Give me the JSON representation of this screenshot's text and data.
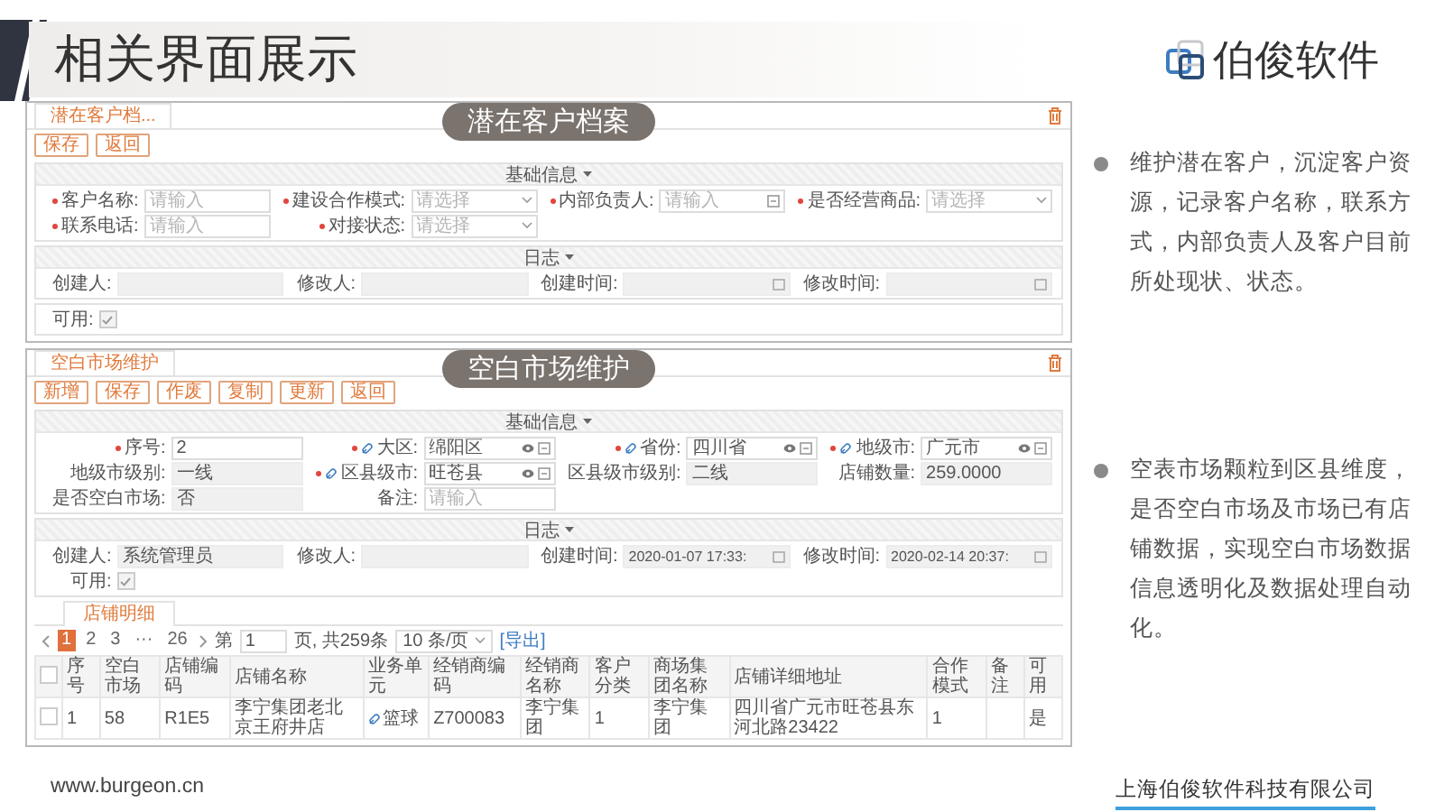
{
  "slide": {
    "title": "相关界面展示",
    "logo": "伯俊软件",
    "website": "www.burgeon.cn",
    "company": "上海伯俊软件科技有限公司"
  },
  "panels": [
    {
      "tab": "潜在客户档...",
      "overlay_title": "潜在客户档案",
      "buttons": [
        "保存",
        "返回"
      ],
      "sections": [
        {
          "title": "基础信息",
          "fields": [
            {
              "kind": "text",
              "label": "客户名称:",
              "required": true,
              "placeholder": "请输入"
            },
            {
              "kind": "select",
              "label": "建设合作模式:",
              "required": true,
              "placeholder": "请选择"
            },
            {
              "kind": "lookup",
              "label": "内部负责人:",
              "required": true,
              "placeholder": "请输入"
            },
            {
              "kind": "select",
              "label": "是否经营商品:",
              "required": true,
              "placeholder": "请选择"
            },
            {
              "kind": "text",
              "label": "联系电话:",
              "required": true,
              "placeholder": "请输入"
            },
            {
              "kind": "select",
              "label": "对接状态:",
              "required": true,
              "placeholder": "请选择"
            }
          ]
        },
        {
          "title": "日志",
          "fields": [
            {
              "kind": "text",
              "label": "创建人:",
              "disabled": true
            },
            {
              "kind": "text",
              "label": "修改人:",
              "disabled": true
            },
            {
              "kind": "date",
              "label": "创建时间:",
              "disabled": true
            },
            {
              "kind": "date",
              "label": "修改时间:",
              "disabled": true
            }
          ]
        },
        {
          "fields": [
            {
              "kind": "checkbox",
              "label": "可用:",
              "checked": true
            }
          ]
        }
      ]
    },
    {
      "tab": "空白市场维护",
      "overlay_title": "空白市场维护",
      "buttons": [
        "新增",
        "保存",
        "作废",
        "复制",
        "更新",
        "返回"
      ],
      "sections": [
        {
          "title": "基础信息",
          "fields": [
            {
              "kind": "text",
              "label": "序号:",
              "required": true,
              "value": "2"
            },
            {
              "kind": "lookup",
              "label": "大区:",
              "required": true,
              "link": true,
              "eye": true,
              "value": "绵阳区"
            },
            {
              "kind": "lookup",
              "label": "省份:",
              "required": true,
              "link": true,
              "eye": true,
              "value": "四川省"
            },
            {
              "kind": "lookup",
              "label": "地级市:",
              "required": true,
              "link": true,
              "eye": true,
              "value": "广元市"
            },
            {
              "kind": "text",
              "label": "地级市级别:",
              "disabled": true,
              "value": "一线"
            },
            {
              "kind": "lookup",
              "label": "区县级市:",
              "required": true,
              "link": true,
              "eye": true,
              "value": "旺苍县"
            },
            {
              "kind": "text",
              "label": "区县级市级别:",
              "disabled": true,
              "value": "二线"
            },
            {
              "kind": "text",
              "label": "店铺数量:",
              "disabled": true,
              "value": "259.0000"
            },
            {
              "kind": "text",
              "label": "是否空白市场:",
              "disabled": true,
              "value": "否"
            },
            {
              "kind": "text",
              "label": "备注:",
              "placeholder": "请输入"
            }
          ]
        },
        {
          "title": "日志",
          "fields": [
            {
              "kind": "text",
              "label": "创建人:",
              "disabled": true,
              "value": "系统管理员"
            },
            {
              "kind": "text",
              "label": "修改人:",
              "disabled": true
            },
            {
              "kind": "date",
              "label": "创建时间:",
              "disabled": true,
              "value": "2020-01-07 17:33:"
            },
            {
              "kind": "date",
              "label": "修改时间:",
              "disabled": true,
              "value": "2020-02-14 20:37:"
            },
            {
              "kind": "checkbox",
              "label": "可用:",
              "checked": true
            }
          ]
        }
      ],
      "details": {
        "tabs": [
          {
            "label": "店铺明细",
            "selected": true
          }
        ],
        "pagination": {
          "pages": [
            {
              "label": "1",
              "selected": true
            },
            {
              "label": "2",
              "selected": false
            },
            {
              "label": "3",
              "selected": false
            },
            {
              "label": "···",
              "selected": false
            },
            {
              "label": "26",
              "selected": false
            }
          ],
          "goto_prefix": "第",
          "goto_value": "1",
          "goto_suffix": "页, 共259条",
          "page_size": "10 条/页",
          "export": "[导出]"
        },
        "table": {
          "header_checked": false,
          "columns": [
            "序号",
            "空白市场",
            "店铺编码",
            "店铺名称",
            "业务单元",
            "经销商编码",
            "经销商名称",
            "客户分类",
            "商场集团名称",
            "店铺详细地址",
            "合作模式",
            "备注",
            "可用"
          ],
          "rows": [
            {
              "checked": false,
              "cells": [
                "1",
                "58",
                "R1E5",
                "李宁集团老北京王府井店",
                {
                  "text": "篮球",
                  "link": true
                },
                "Z700083",
                "李宁集团",
                "1",
                "李宁集团",
                "四川省广元市旺苍县东河北路23422",
                "1",
                null,
                "是"
              ]
            }
          ]
        }
      }
    }
  ],
  "bullets": [
    "维护潜在客户，沉淀客户资源，记录客户名称，联系方式，内部负责人及客户目前所处现状、状态。",
    "空表市场颗粒到区县维度，是否空白市场及市场已有店铺数据，实现空白市场数据信息透明化及数据处理自动化。"
  ]
}
